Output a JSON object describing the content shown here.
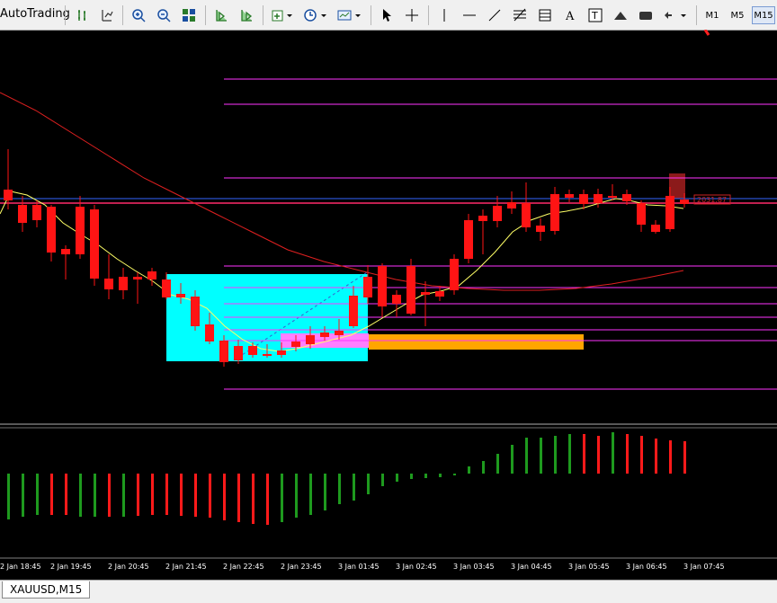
{
  "toolbar": {
    "autotrading_label": "AutoTrading",
    "timeframes": [
      "M1",
      "M5",
      "M15"
    ],
    "active_timeframe": "M15"
  },
  "chart": {
    "symbol_tab": "XAUUSD,M15",
    "price_tag": "2031.87",
    "time_labels": [
      "2 Jan 18:45",
      "2 Jan 19:45",
      "2 Jan 20:45",
      "2 Jan 21:45",
      "2 Jan 22:45",
      "2 Jan 23:45",
      "3 Jan 01:45",
      "3 Jan 02:45",
      "3 Jan 03:45",
      "3 Jan 04:45",
      "3 Jan 05:45",
      "3 Jan 06:45",
      "3 Jan 07:45"
    ],
    "colors": {
      "bull": "#1414ff",
      "bear": "#ff1414",
      "hist_up": "#1e9a1e",
      "hist_down": "#ff1a1a",
      "ma_fast": "#ffff66",
      "ma_slow": "#e02020",
      "level": "#ff33ff",
      "zone": "#00ffff",
      "box": "#ff7fff",
      "band": "#ffa500"
    }
  }
}
